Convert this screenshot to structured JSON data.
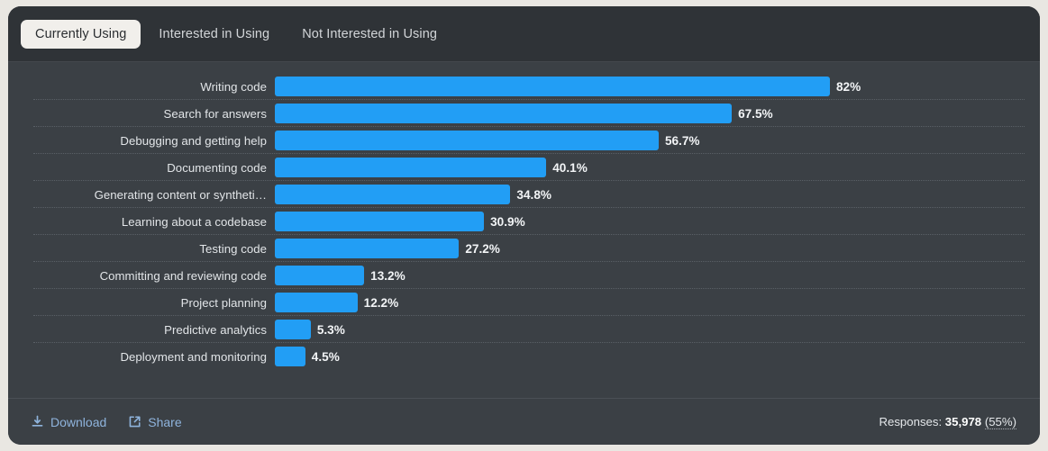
{
  "tabs": [
    {
      "label": "Currently Using",
      "active": true
    },
    {
      "label": "Interested in Using",
      "active": false
    },
    {
      "label": "Not Interested in Using",
      "active": false
    }
  ],
  "footer": {
    "download_label": "Download",
    "download_icon": "download-icon",
    "share_label": "Share",
    "share_icon": "external-link-icon",
    "responses_prefix": "Responses:",
    "responses_count": "35,978",
    "responses_percent": "(55%)"
  },
  "colors": {
    "bar": "#229ef5",
    "card_bg": "#3b4045",
    "header_bg": "#2f3337",
    "page_bg": "#e9e7e2",
    "active_tab_bg": "#f1efeb",
    "link": "#8fb4dd",
    "gridline": "#5a6066"
  },
  "chart_data": {
    "type": "bar",
    "orientation": "horizontal",
    "title": "",
    "xlabel": "",
    "ylabel": "",
    "xlim": [
      0,
      100
    ],
    "grid": true,
    "value_suffix": "%",
    "categories": [
      "Writing code",
      "Search for answers",
      "Debugging and getting help",
      "Documenting code",
      "Generating content or syntheti…",
      "Learning about a codebase",
      "Testing code",
      "Committing and reviewing code",
      "Project planning",
      "Predictive analytics",
      "Deployment and monitoring"
    ],
    "values": [
      82,
      67.5,
      56.7,
      40.1,
      34.8,
      30.9,
      27.2,
      13.2,
      12.2,
      5.3,
      4.5
    ],
    "value_labels": [
      "82%",
      "67.5%",
      "56.7%",
      "40.1%",
      "34.8%",
      "30.9%",
      "27.2%",
      "13.2%",
      "12.2%",
      "5.3%",
      "4.5%"
    ]
  }
}
